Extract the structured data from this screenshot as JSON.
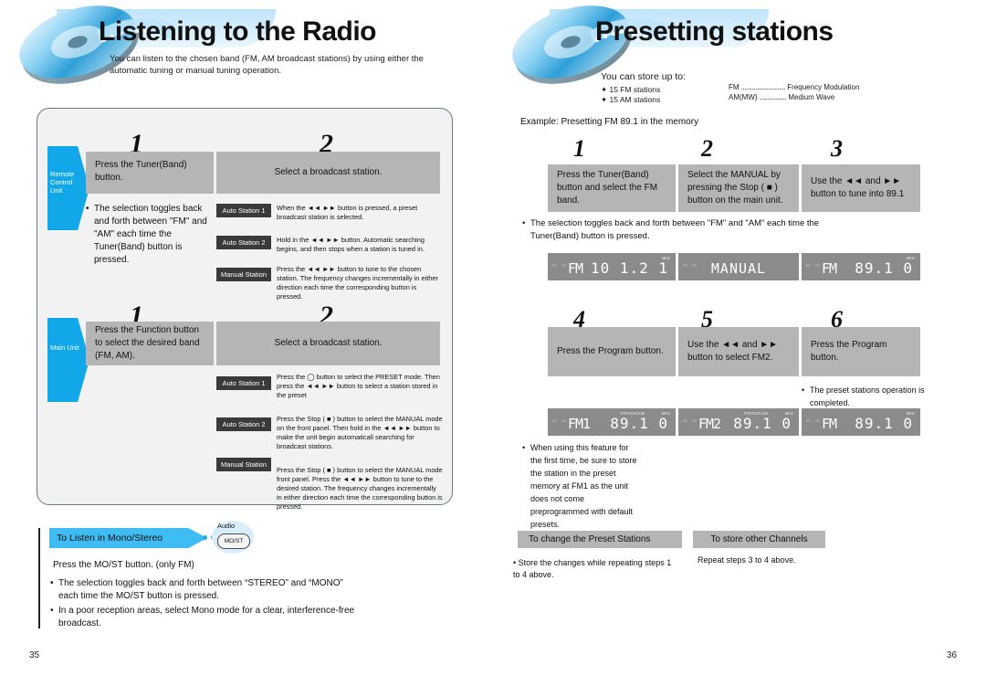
{
  "left_page": {
    "header": {
      "title": "Listening to the Radio",
      "subtitle": "You can listen to the chosen band (FM, AM broadcast stations) by using either the automatic tuning or manual tuning operation."
    },
    "remote_section": {
      "tab_label": "Remote Control Unit",
      "step1_number": "1",
      "step1_text": "Press the Tuner(Band) button.",
      "step1_bullet": "The selection toggles back and forth between \"FM\" and \"AM\" each time the Tuner(Band)  button is pressed.",
      "step2_number": "2",
      "step2_text": "Select a broadcast station.",
      "rows": [
        {
          "badge": "Auto Station 1",
          "desc": "When the ◄◄ ►► button is pressed, a preset broadcast station is selected."
        },
        {
          "badge": "Auto Station 2",
          "desc": "Hold in the ◄◄ ►► button. Automatic searching begins, and then stops when a station is tuned in."
        },
        {
          "badge": "Manual Station",
          "desc": "Press the ◄◄ ►►  button to tune to the chosen station. The frequency changes incrementally in either direction each time the corresponding button is pressed."
        }
      ]
    },
    "main_section": {
      "tab_label": "Main Unit",
      "step1_number": "1",
      "step1_text": "Press the Function  button to select the desired band (FM, AM).",
      "step2_number": "2",
      "step2_text": "Select a broadcast station.",
      "rows": [
        {
          "badge": "Auto Station 1",
          "desc": "Press the ◯ button to select the PRESET mode. Then press the ◄◄ ►► button to select a station stored in the preset"
        },
        {
          "badge": "Auto Station 2",
          "desc": "Press the Stop ( ■ ) button to select the MANUAL mode on the front panel. Then hold in the ◄◄ ►► button to make the unit begin automaticall searching for broadcast stations."
        },
        {
          "badge": "Manual Station",
          "desc": "Press the Stop ( ■ )  button to select the MANUAL mode front panel. Press the ◄◄ ►► button to tune to the desired station. The frequency changes incrementally in either direction each time the corresponding button is pressed."
        }
      ]
    },
    "mono_stereo": {
      "banner_label": "To Listen in Mono/Stereo",
      "button_caption": "Audio",
      "button_label": "MO/ST",
      "line1": "Press the MO/ST button.   (only FM)",
      "bullets": [
        "The selection toggles back and forth between “STEREO” and “MONO” each time the MO/ST button is pressed.",
        "In a poor reception areas, select Mono mode for a clear, interference-free broadcast."
      ]
    },
    "page_number": "35"
  },
  "right_page": {
    "header": {
      "title": "Presetting stations",
      "store_title": "You can store up to:",
      "store_items": [
        "15 FM stations",
        "15 AM stations"
      ],
      "band_items": [
        {
          "name": "FM",
          "dots": "............................",
          "value": "Frequency Modulation"
        },
        {
          "name": "AM(MW)",
          "dots": ".................",
          "value": "Medium Wave"
        }
      ]
    },
    "example_label": "Example: Presetting FM 89.1 in the memory",
    "steps_row1": [
      {
        "number": "1",
        "text": "Press the Tuner(Band)  button and select the FM band."
      },
      {
        "number": "2",
        "text": "Select the MANUAL by pressing the Stop ( ■ )  button on the main unit."
      },
      {
        "number": "3",
        "text": "Use the ◄◄  and ►► button to tune into 89.1"
      }
    ],
    "row1_bullet": "The selection toggles back and forth between \"FM\" and \"AM\" each time the Tuner(Band)  button is pressed.",
    "lcds_row1": [
      {
        "band": "FM",
        "freq": "10 1.2 1",
        "program": "",
        "unit": "MHz",
        "mode": ""
      },
      {
        "band": "",
        "freq": "",
        "program": "",
        "unit": "",
        "mode": "MANUAL"
      },
      {
        "band": "FM",
        "freq": "89.1 0",
        "program": "",
        "unit": "MHz",
        "mode": ""
      }
    ],
    "steps_row2": [
      {
        "number": "4",
        "text": "Press the Program  button."
      },
      {
        "number": "5",
        "text": "Use the ◄◄  and  ►► button to select FM2."
      },
      {
        "number": "6",
        "text": "Press the Program  button."
      }
    ],
    "row2_bullet": "The preset stations operation is completed.",
    "lcds_row2": [
      {
        "band": "FM1",
        "freq": "89.1 0",
        "program": "PROGRAM",
        "unit": "MHz",
        "mode": ""
      },
      {
        "band": "FM2",
        "freq": "89.1 0",
        "program": "PROGRAM",
        "unit": "MHz",
        "mode": ""
      },
      {
        "band": "FM",
        "freq": "89.1 0",
        "program": "",
        "unit": "MHz",
        "mode": ""
      }
    ],
    "final_note": "When using this feature for the first time, be sure to store the station in the preset memory at FM1 as the unit does not come preprogrammed with default presets.",
    "bottom": {
      "cap1_title": "To change the Preset Stations",
      "cap1_text": "Store the changes while repeating steps 1 to 4 above.",
      "cap2_title": "To store other Channels",
      "cap2_text": "Repeat steps 3 to 4 above."
    },
    "page_number": "36"
  },
  "colors": {
    "accent_blue": "#11a7e8",
    "panel_gray": "#b5b5b5",
    "badge_dark": "#3a3a3a",
    "box_bg": "#f2f2f2",
    "box_border": "#6b7781",
    "lcd_bg": "#8b8b8b"
  }
}
